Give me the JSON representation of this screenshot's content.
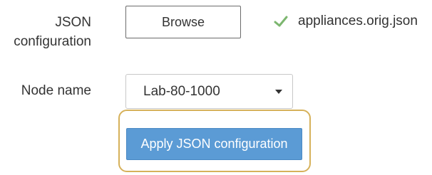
{
  "form": {
    "json_label_line1": "JSON",
    "json_label_line2": "configuration",
    "browse_label": "Browse",
    "file_name": "appliances.orig.json",
    "node_label": "Node name",
    "node_value": "Lab-80-1000",
    "apply_label": "Apply JSON configuration"
  },
  "colors": {
    "check": "#7cb66f",
    "apply_button": "#5b9bd5",
    "focus_ring": "#d6b15a"
  },
  "icons": {
    "check": "check-icon",
    "caret": "caret-down-icon"
  }
}
